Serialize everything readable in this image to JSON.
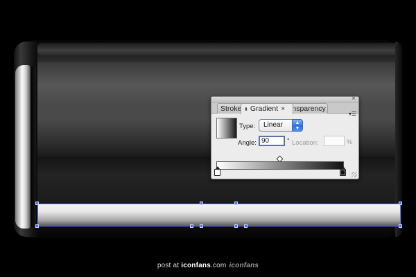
{
  "panel": {
    "tabs": [
      {
        "label": "Stroke"
      },
      {
        "label": "Gradient"
      },
      {
        "label": "Transparency"
      }
    ],
    "type_label": "Type:",
    "type_value": "Linear",
    "angle_label": "Angle:",
    "angle_value": "90",
    "angle_unit": "°",
    "location_label": "Location:",
    "location_value": "",
    "location_unit": "%",
    "close_glyph": "×",
    "tab_close_glyph": "×",
    "gradient_start_color": "#ffffff",
    "gradient_end_color": "#111111"
  },
  "footer": {
    "prefix": "post at ",
    "brand": "iconfans",
    "suffix": ".com",
    "logo": "iconfans"
  },
  "colors": {
    "selection": "#4a6dff",
    "background": "#000000"
  }
}
